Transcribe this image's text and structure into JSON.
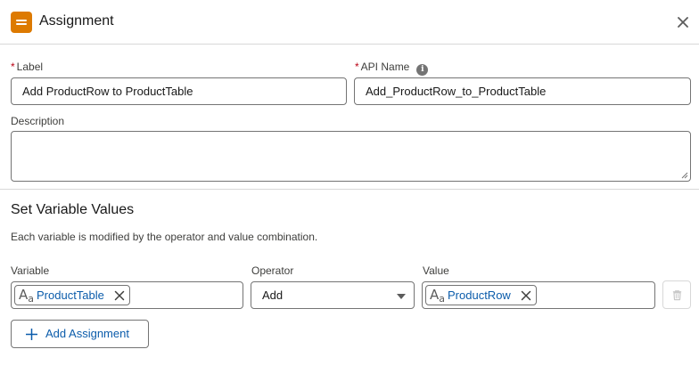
{
  "header": {
    "title": "Assignment",
    "icon": "assignment-icon",
    "close_icon": "close-icon",
    "accent_color": "#dd7a01"
  },
  "fields": {
    "required_marker": "*",
    "label": {
      "label": "Label",
      "value": "Add ProductRow to ProductTable"
    },
    "api_name": {
      "label": "API Name",
      "value": "Add_ProductRow_to_ProductTable",
      "info_icon": "info-icon",
      "info_glyph": "i"
    },
    "description": {
      "label": "Description",
      "value": ""
    }
  },
  "section": {
    "title": "Set Variable Values",
    "description": "Each variable is modified by the operator and value combination."
  },
  "columns": {
    "variable": "Variable",
    "operator": "Operator",
    "value": "Value"
  },
  "assignment_row": {
    "variable_pill": "ProductTable",
    "operator": "Add",
    "value_pill": "ProductRow",
    "resource_icon": "text-resource-icon",
    "delete_icon": "trash-icon"
  },
  "add_button": {
    "label": "Add Assignment",
    "icon": "plus-icon"
  },
  "colors": {
    "link_blue": "#0b5cab",
    "required_red": "#ba0517",
    "border": "#747474"
  }
}
